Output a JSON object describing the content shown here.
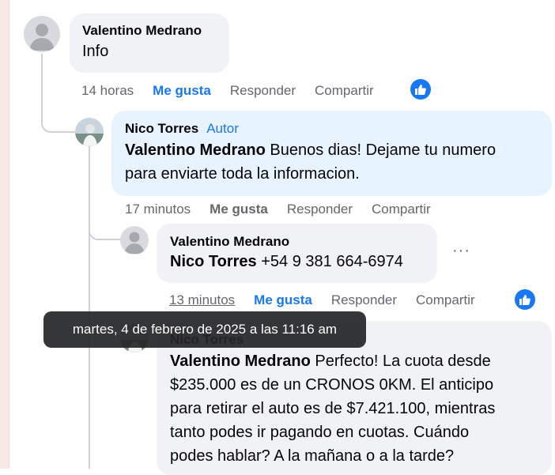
{
  "comments": [
    {
      "author": "Valentino Medrano",
      "text": "Info",
      "time": "14 horas",
      "like": "Me gusta",
      "reply": "Responder",
      "share": "Compartir"
    },
    {
      "author": "Nico Torres",
      "badge": "Autor",
      "mention": "Valentino Medrano",
      "text_line1": "Buenos dias! Dejame tu numero",
      "text_line2": "para enviarte toda la informacion.",
      "time": "17 minutos",
      "like": "Me gusta",
      "reply": "Responder",
      "share": "Compartir"
    },
    {
      "author": "Valentino Medrano",
      "mention": "Nico Torres",
      "text": "+54 9 381 664-6974",
      "more": "···",
      "time": "13 minutos",
      "like": "Me gusta",
      "reply": "Responder",
      "share": "Compartir"
    },
    {
      "author": "Nico Torres",
      "mention": "Valentino Medrano",
      "text_line1": "Perfecto! La cuota desde",
      "text_line2": "$235.000 es de un CRONOS 0KM. El anticipo",
      "text_line3": "para retirar el auto es de $7.421.100, mientras",
      "text_line4": "tanto podes ir pagando en cuotas. Cuándo",
      "text_line5": "podes hablar? A la mañana o a la tarde?"
    }
  ],
  "tooltip": "martes, 4 de febrero de 2025 a las 11:16 am",
  "icons": {
    "avatar": "default-avatar-icon",
    "photo": "profile-photo",
    "like": "thumbs-up-icon",
    "more": "more-options-icon"
  },
  "colors": {
    "accent": "#1877f2",
    "bubble": "#f0f2f5",
    "author_bubble": "#e7f3ff",
    "secondary_text": "#65676b"
  }
}
